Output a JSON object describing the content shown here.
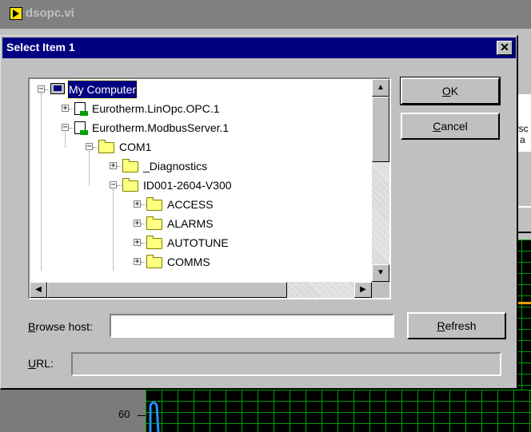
{
  "background_window": {
    "title": "dsopc.vi",
    "side_text": [
      "wsc",
      "e a"
    ],
    "graph": {
      "axis_label": "60"
    }
  },
  "dialog": {
    "title": "Select Item 1",
    "close_label": "✕",
    "tree": {
      "nodes": [
        {
          "label": "My Computer",
          "icon": "computer-icon",
          "expander": "−",
          "selected": true
        },
        {
          "label": "Eurotherm.LinOpc.OPC.1",
          "icon": "server-icon",
          "expander": "+"
        },
        {
          "label": "Eurotherm.ModbusServer.1",
          "icon": "server-icon",
          "expander": "−"
        },
        {
          "label": "COM1",
          "icon": "folder-icon",
          "expander": "−"
        },
        {
          "label": "_Diagnostics",
          "icon": "folder-icon",
          "expander": "+"
        },
        {
          "label": "ID001-2604-V300",
          "icon": "folder-icon",
          "expander": "−"
        },
        {
          "label": "ACCESS",
          "icon": "folder-icon",
          "expander": "+"
        },
        {
          "label": "ALARMS",
          "icon": "folder-icon",
          "expander": "+"
        },
        {
          "label": "AUTOTUNE",
          "icon": "folder-icon",
          "expander": "+"
        },
        {
          "label": "COMMS",
          "icon": "folder-icon",
          "expander": "+"
        }
      ]
    },
    "buttons": {
      "ok_mnemonic": "O",
      "ok_rest": "K",
      "cancel_mnemonic": "C",
      "cancel_rest": "ancel",
      "refresh_mnemonic": "R",
      "refresh_rest": "efresh"
    },
    "browse_host": {
      "label_mnemonic": "B",
      "label_rest": "rowse host:",
      "value": ""
    },
    "url": {
      "label_mnemonic": "U",
      "label_rest": "RL:",
      "value": ""
    }
  }
}
